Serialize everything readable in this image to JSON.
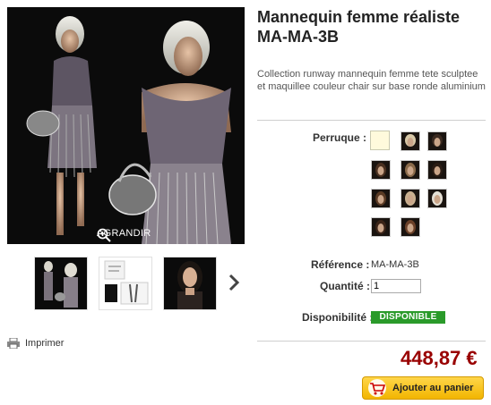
{
  "product": {
    "title": "Mannequin femme réaliste MA-MA-3B",
    "description": "Collection runway mannequin femme tete sculptee et maquillee couleur chair sur base ronde aluminium"
  },
  "gallery": {
    "zoom_label": "AGRANDIR",
    "thumbnails": [
      "thumb-1",
      "thumb-2",
      "thumb-3"
    ]
  },
  "print_label": "Imprimer",
  "options": {
    "perruque_label": "Perruque :",
    "swatch_count": 10
  },
  "details": {
    "reference_label": "Référence :",
    "reference_value": "MA-MA-3B",
    "quantity_label": "Quantité :",
    "quantity_value": "1",
    "availability_label": "Disponibilité :",
    "availability_value": "DISPONIBLE"
  },
  "price": "448,87 €",
  "cart_button": "Ajouter au panier",
  "colors": {
    "price": "#990000",
    "badge": "#2a9a2a",
    "button": "#f2b500"
  }
}
